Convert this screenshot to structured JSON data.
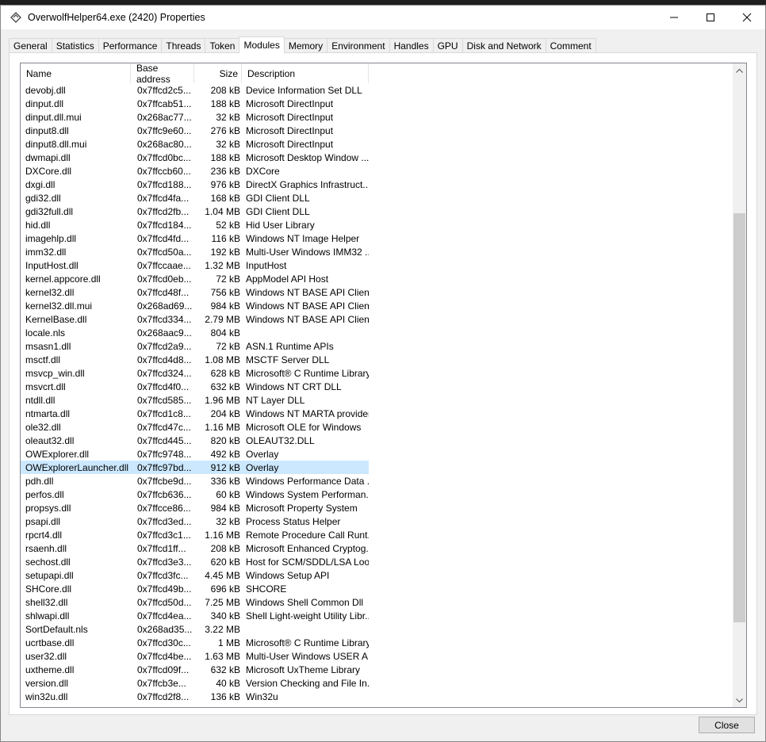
{
  "window": {
    "title": "OverwolfHelper64.exe (2420) Properties"
  },
  "tabs": [
    "General",
    "Statistics",
    "Performance",
    "Threads",
    "Token",
    "Modules",
    "Memory",
    "Environment",
    "Handles",
    "GPU",
    "Disk and Network",
    "Comment"
  ],
  "active_tab": "Modules",
  "columns": {
    "name": "Name",
    "base": "Base address",
    "size": "Size",
    "desc": "Description"
  },
  "rows": [
    [
      "devobj.dll",
      "0x7ffcd2c5...",
      "208 kB",
      "Device Information Set DLL"
    ],
    [
      "dinput.dll",
      "0x7ffcab51...",
      "188 kB",
      "Microsoft DirectInput"
    ],
    [
      "dinput.dll.mui",
      "0x268ac77...",
      "32 kB",
      "Microsoft DirectInput"
    ],
    [
      "dinput8.dll",
      "0x7ffc9e60...",
      "276 kB",
      "Microsoft DirectInput"
    ],
    [
      "dinput8.dll.mui",
      "0x268ac80...",
      "32 kB",
      "Microsoft DirectInput"
    ],
    [
      "dwmapi.dll",
      "0x7ffcd0bc...",
      "188 kB",
      "Microsoft Desktop Window ..."
    ],
    [
      "DXCore.dll",
      "0x7ffccb60...",
      "236 kB",
      "DXCore"
    ],
    [
      "dxgi.dll",
      "0x7ffcd188...",
      "976 kB",
      "DirectX Graphics Infrastruct..."
    ],
    [
      "gdi32.dll",
      "0x7ffcd4fa...",
      "168 kB",
      "GDI Client DLL"
    ],
    [
      "gdi32full.dll",
      "0x7ffcd2fb...",
      "1.04 MB",
      "GDI Client DLL"
    ],
    [
      "hid.dll",
      "0x7ffcd184...",
      "52 kB",
      "Hid User Library"
    ],
    [
      "imagehlp.dll",
      "0x7ffcd4fd...",
      "116 kB",
      "Windows NT Image Helper"
    ],
    [
      "imm32.dll",
      "0x7ffcd50a...",
      "192 kB",
      "Multi-User Windows IMM32 ..."
    ],
    [
      "InputHost.dll",
      "0x7ffccaae...",
      "1.32 MB",
      "InputHost"
    ],
    [
      "kernel.appcore.dll",
      "0x7ffcd0eb...",
      "72 kB",
      "AppModel API Host"
    ],
    [
      "kernel32.dll",
      "0x7ffcd48f...",
      "756 kB",
      "Windows NT BASE API Clien..."
    ],
    [
      "kernel32.dll.mui",
      "0x268ad69...",
      "984 kB",
      "Windows NT BASE API Clien..."
    ],
    [
      "KernelBase.dll",
      "0x7ffcd334...",
      "2.79 MB",
      "Windows NT BASE API Clien..."
    ],
    [
      "locale.nls",
      "0x268aac9...",
      "804 kB",
      ""
    ],
    [
      "msasn1.dll",
      "0x7ffcd2a9...",
      "72 kB",
      "ASN.1 Runtime APIs"
    ],
    [
      "msctf.dll",
      "0x7ffcd4d8...",
      "1.08 MB",
      "MSCTF Server DLL"
    ],
    [
      "msvcp_win.dll",
      "0x7ffcd324...",
      "628 kB",
      "Microsoft® C Runtime Library"
    ],
    [
      "msvcrt.dll",
      "0x7ffcd4f0...",
      "632 kB",
      "Windows NT CRT DLL"
    ],
    [
      "ntdll.dll",
      "0x7ffcd585...",
      "1.96 MB",
      "NT Layer DLL"
    ],
    [
      "ntmarta.dll",
      "0x7ffcd1c8...",
      "204 kB",
      "Windows NT MARTA provider"
    ],
    [
      "ole32.dll",
      "0x7ffcd47c...",
      "1.16 MB",
      "Microsoft OLE for Windows"
    ],
    [
      "oleaut32.dll",
      "0x7ffcd445...",
      "820 kB",
      "OLEAUT32.DLL"
    ],
    [
      "OWExplorer.dll",
      "0x7ffc9748...",
      "492 kB",
      "Overlay"
    ],
    [
      "OWExplorerLauncher.dll",
      "0x7ffc97bd...",
      "912 kB",
      "Overlay"
    ],
    [
      "pdh.dll",
      "0x7ffcbe9d...",
      "336 kB",
      "Windows Performance Data ..."
    ],
    [
      "perfos.dll",
      "0x7ffcb636...",
      "60 kB",
      "Windows System Performan..."
    ],
    [
      "propsys.dll",
      "0x7ffcce86...",
      "984 kB",
      "Microsoft Property System"
    ],
    [
      "psapi.dll",
      "0x7ffcd3ed...",
      "32 kB",
      "Process Status Helper"
    ],
    [
      "rpcrt4.dll",
      "0x7ffcd3c1...",
      "1.16 MB",
      "Remote Procedure Call Runt..."
    ],
    [
      "rsaenh.dll",
      "0x7ffcd1ff...",
      "208 kB",
      "Microsoft Enhanced Cryptog..."
    ],
    [
      "sechost.dll",
      "0x7ffcd3e3...",
      "620 kB",
      "Host for SCM/SDDL/LSA Loo..."
    ],
    [
      "setupapi.dll",
      "0x7ffcd3fc...",
      "4.45 MB",
      "Windows Setup API"
    ],
    [
      "SHCore.dll",
      "0x7ffcd49b...",
      "696 kB",
      "SHCORE"
    ],
    [
      "shell32.dll",
      "0x7ffcd50d...",
      "7.25 MB",
      "Windows Shell Common Dll"
    ],
    [
      "shlwapi.dll",
      "0x7ffcd4ea...",
      "340 kB",
      "Shell Light-weight Utility Libr..."
    ],
    [
      "SortDefault.nls",
      "0x268ad35...",
      "3.22 MB",
      ""
    ],
    [
      "ucrtbase.dll",
      "0x7ffcd30c...",
      "1 MB",
      "Microsoft® C Runtime Library"
    ],
    [
      "user32.dll",
      "0x7ffcd4be...",
      "1.63 MB",
      "Multi-User Windows USER A..."
    ],
    [
      "uxtheme.dll",
      "0x7ffcd09f...",
      "632 kB",
      "Microsoft UxTheme Library"
    ],
    [
      "version.dll",
      "0x7ffcb3e...",
      "40 kB",
      "Version Checking and File In..."
    ],
    [
      "win32u.dll",
      "0x7ffcd2f8...",
      "136 kB",
      "Win32u"
    ]
  ],
  "selected_row": "OWExplorerLauncher.dll",
  "close_label": "Close"
}
